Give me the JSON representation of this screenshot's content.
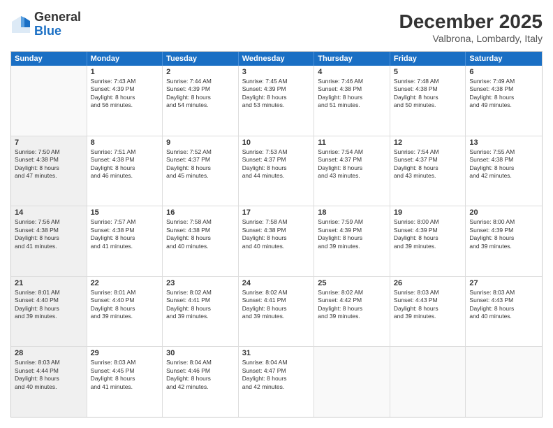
{
  "logo": {
    "general": "General",
    "blue": "Blue"
  },
  "header": {
    "month": "December 2025",
    "location": "Valbrona, Lombardy, Italy"
  },
  "days": [
    "Sunday",
    "Monday",
    "Tuesday",
    "Wednesday",
    "Thursday",
    "Friday",
    "Saturday"
  ],
  "rows": [
    [
      {
        "day": "",
        "empty": true
      },
      {
        "day": "1",
        "line1": "Sunrise: 7:43 AM",
        "line2": "Sunset: 4:39 PM",
        "line3": "Daylight: 8 hours",
        "line4": "and 56 minutes."
      },
      {
        "day": "2",
        "line1": "Sunrise: 7:44 AM",
        "line2": "Sunset: 4:39 PM",
        "line3": "Daylight: 8 hours",
        "line4": "and 54 minutes."
      },
      {
        "day": "3",
        "line1": "Sunrise: 7:45 AM",
        "line2": "Sunset: 4:39 PM",
        "line3": "Daylight: 8 hours",
        "line4": "and 53 minutes."
      },
      {
        "day": "4",
        "line1": "Sunrise: 7:46 AM",
        "line2": "Sunset: 4:38 PM",
        "line3": "Daylight: 8 hours",
        "line4": "and 51 minutes."
      },
      {
        "day": "5",
        "line1": "Sunrise: 7:48 AM",
        "line2": "Sunset: 4:38 PM",
        "line3": "Daylight: 8 hours",
        "line4": "and 50 minutes."
      },
      {
        "day": "6",
        "line1": "Sunrise: 7:49 AM",
        "line2": "Sunset: 4:38 PM",
        "line3": "Daylight: 8 hours",
        "line4": "and 49 minutes."
      }
    ],
    [
      {
        "day": "7",
        "shaded": true,
        "line1": "Sunrise: 7:50 AM",
        "line2": "Sunset: 4:38 PM",
        "line3": "Daylight: 8 hours",
        "line4": "and 47 minutes."
      },
      {
        "day": "8",
        "line1": "Sunrise: 7:51 AM",
        "line2": "Sunset: 4:38 PM",
        "line3": "Daylight: 8 hours",
        "line4": "and 46 minutes."
      },
      {
        "day": "9",
        "line1": "Sunrise: 7:52 AM",
        "line2": "Sunset: 4:37 PM",
        "line3": "Daylight: 8 hours",
        "line4": "and 45 minutes."
      },
      {
        "day": "10",
        "line1": "Sunrise: 7:53 AM",
        "line2": "Sunset: 4:37 PM",
        "line3": "Daylight: 8 hours",
        "line4": "and 44 minutes."
      },
      {
        "day": "11",
        "line1": "Sunrise: 7:54 AM",
        "line2": "Sunset: 4:37 PM",
        "line3": "Daylight: 8 hours",
        "line4": "and 43 minutes."
      },
      {
        "day": "12",
        "line1": "Sunrise: 7:54 AM",
        "line2": "Sunset: 4:37 PM",
        "line3": "Daylight: 8 hours",
        "line4": "and 43 minutes."
      },
      {
        "day": "13",
        "line1": "Sunrise: 7:55 AM",
        "line2": "Sunset: 4:38 PM",
        "line3": "Daylight: 8 hours",
        "line4": "and 42 minutes."
      }
    ],
    [
      {
        "day": "14",
        "shaded": true,
        "line1": "Sunrise: 7:56 AM",
        "line2": "Sunset: 4:38 PM",
        "line3": "Daylight: 8 hours",
        "line4": "and 41 minutes."
      },
      {
        "day": "15",
        "line1": "Sunrise: 7:57 AM",
        "line2": "Sunset: 4:38 PM",
        "line3": "Daylight: 8 hours",
        "line4": "and 41 minutes."
      },
      {
        "day": "16",
        "line1": "Sunrise: 7:58 AM",
        "line2": "Sunset: 4:38 PM",
        "line3": "Daylight: 8 hours",
        "line4": "and 40 minutes."
      },
      {
        "day": "17",
        "line1": "Sunrise: 7:58 AM",
        "line2": "Sunset: 4:38 PM",
        "line3": "Daylight: 8 hours",
        "line4": "and 40 minutes."
      },
      {
        "day": "18",
        "line1": "Sunrise: 7:59 AM",
        "line2": "Sunset: 4:39 PM",
        "line3": "Daylight: 8 hours",
        "line4": "and 39 minutes."
      },
      {
        "day": "19",
        "line1": "Sunrise: 8:00 AM",
        "line2": "Sunset: 4:39 PM",
        "line3": "Daylight: 8 hours",
        "line4": "and 39 minutes."
      },
      {
        "day": "20",
        "line1": "Sunrise: 8:00 AM",
        "line2": "Sunset: 4:39 PM",
        "line3": "Daylight: 8 hours",
        "line4": "and 39 minutes."
      }
    ],
    [
      {
        "day": "21",
        "shaded": true,
        "line1": "Sunrise: 8:01 AM",
        "line2": "Sunset: 4:40 PM",
        "line3": "Daylight: 8 hours",
        "line4": "and 39 minutes."
      },
      {
        "day": "22",
        "line1": "Sunrise: 8:01 AM",
        "line2": "Sunset: 4:40 PM",
        "line3": "Daylight: 8 hours",
        "line4": "and 39 minutes."
      },
      {
        "day": "23",
        "line1": "Sunrise: 8:02 AM",
        "line2": "Sunset: 4:41 PM",
        "line3": "Daylight: 8 hours",
        "line4": "and 39 minutes."
      },
      {
        "day": "24",
        "line1": "Sunrise: 8:02 AM",
        "line2": "Sunset: 4:41 PM",
        "line3": "Daylight: 8 hours",
        "line4": "and 39 minutes."
      },
      {
        "day": "25",
        "line1": "Sunrise: 8:02 AM",
        "line2": "Sunset: 4:42 PM",
        "line3": "Daylight: 8 hours",
        "line4": "and 39 minutes."
      },
      {
        "day": "26",
        "line1": "Sunrise: 8:03 AM",
        "line2": "Sunset: 4:43 PM",
        "line3": "Daylight: 8 hours",
        "line4": "and 39 minutes."
      },
      {
        "day": "27",
        "line1": "Sunrise: 8:03 AM",
        "line2": "Sunset: 4:43 PM",
        "line3": "Daylight: 8 hours",
        "line4": "and 40 minutes."
      }
    ],
    [
      {
        "day": "28",
        "shaded": true,
        "line1": "Sunrise: 8:03 AM",
        "line2": "Sunset: 4:44 PM",
        "line3": "Daylight: 8 hours",
        "line4": "and 40 minutes."
      },
      {
        "day": "29",
        "line1": "Sunrise: 8:03 AM",
        "line2": "Sunset: 4:45 PM",
        "line3": "Daylight: 8 hours",
        "line4": "and 41 minutes."
      },
      {
        "day": "30",
        "line1": "Sunrise: 8:04 AM",
        "line2": "Sunset: 4:46 PM",
        "line3": "Daylight: 8 hours",
        "line4": "and 42 minutes."
      },
      {
        "day": "31",
        "line1": "Sunrise: 8:04 AM",
        "line2": "Sunset: 4:47 PM",
        "line3": "Daylight: 8 hours",
        "line4": "and 42 minutes."
      },
      {
        "day": "",
        "empty": true
      },
      {
        "day": "",
        "empty": true
      },
      {
        "day": "",
        "empty": true
      }
    ]
  ]
}
